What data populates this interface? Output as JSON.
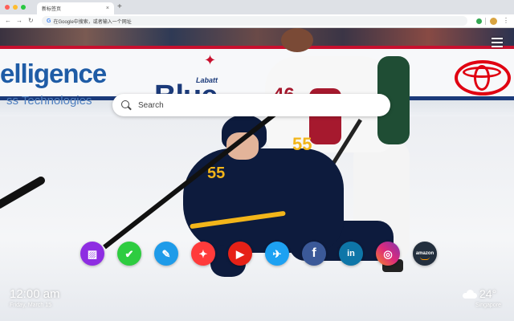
{
  "browser": {
    "traffic_lights": [
      "#ff5f57",
      "#febc2e",
      "#28c840"
    ],
    "tab": {
      "title": "新标签页",
      "close": "×"
    },
    "new_tab": "+",
    "nav": {
      "back": "←",
      "forward": "→",
      "reload": "↻"
    },
    "omnibox": {
      "g_icon": "G",
      "text": "在Google中搜索，或者输入一个网址"
    },
    "menu": "⋮"
  },
  "scene": {
    "ads": {
      "intelligence": "elligence",
      "intelligence_sub": "ss Technologies",
      "labatt": "Labatt",
      "blue": "Blue"
    },
    "numbers": {
      "wild": "46",
      "sabres_chest": "55",
      "sabres_arm": "55"
    }
  },
  "newtab": {
    "search": {
      "placeholder": "Search"
    },
    "apps": [
      {
        "name": "gallery",
        "glyph": "▨",
        "color": "#8e2de2"
      },
      {
        "name": "tasks",
        "glyph": "✔",
        "color": "#2ecc40"
      },
      {
        "name": "notes",
        "glyph": "✎",
        "color": "#1e9be9"
      },
      {
        "name": "games",
        "glyph": "✦",
        "color": "#ff3b3b"
      },
      {
        "name": "youtube",
        "glyph": "▶",
        "color": "#e62117"
      },
      {
        "name": "twitter",
        "glyph": "✈",
        "color": "#1da1f2"
      },
      {
        "name": "facebook",
        "glyph": "f",
        "color": "#3b5998"
      },
      {
        "name": "linkedin",
        "glyph": "in",
        "color": "#0e76a8"
      },
      {
        "name": "instagram",
        "glyph": "◎",
        "color": "#e1306c"
      },
      {
        "name": "amazon",
        "glyph": "amazon",
        "color": "#232f3e"
      }
    ],
    "clock": "12:00 am",
    "date": "Friday, March 15",
    "weather": {
      "temp": "24°",
      "location": "Singapore"
    }
  }
}
